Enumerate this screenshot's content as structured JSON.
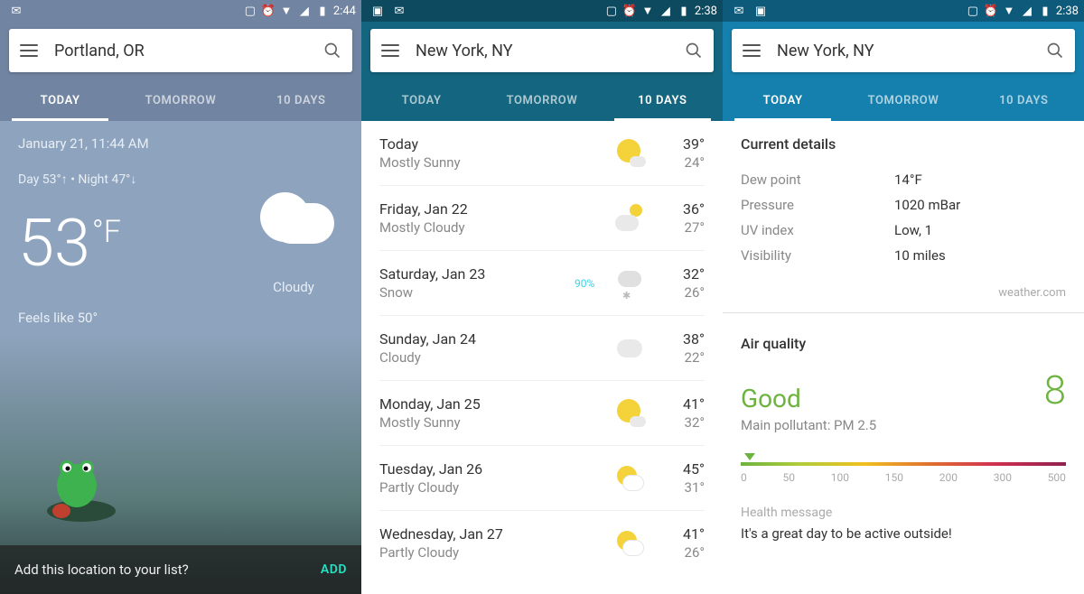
{
  "phoneA": {
    "status_time": "2:44",
    "location": "Portland, OR",
    "tabs": [
      "TODAY",
      "TOMORROW",
      "10 DAYS"
    ],
    "active_tab": 0,
    "date_time": "January 21, 11:44 AM",
    "range": "Day 53°↑ • Night 47°↓",
    "temp": "53",
    "unit": "°F",
    "feels": "Feels like 50°",
    "condition": "Cloudy",
    "prompt": "Add this location to your list?",
    "add_label": "ADD"
  },
  "phoneB": {
    "status_time": "2:38",
    "location": "New York, NY",
    "tabs": [
      "TODAY",
      "TOMORROW",
      "10 DAYS"
    ],
    "active_tab": 2,
    "forecast": [
      {
        "day": "Today",
        "cond": "Mostly Sunny",
        "hi": "39°",
        "lo": "24°",
        "icon": "sun",
        "precip": ""
      },
      {
        "day": "Friday, Jan 22",
        "cond": "Mostly Cloudy",
        "hi": "36°",
        "lo": "27°",
        "icon": "mc",
        "precip": ""
      },
      {
        "day": "Saturday, Jan 23",
        "cond": "Snow",
        "hi": "32°",
        "lo": "26°",
        "icon": "sn",
        "precip": "90%"
      },
      {
        "day": "Sunday, Jan 24",
        "cond": "Cloudy",
        "hi": "38°",
        "lo": "22°",
        "icon": "cl",
        "precip": ""
      },
      {
        "day": "Monday, Jan 25",
        "cond": "Mostly Sunny",
        "hi": "41°",
        "lo": "32°",
        "icon": "sun",
        "precip": ""
      },
      {
        "day": "Tuesday, Jan 26",
        "cond": "Partly Cloudy",
        "hi": "45°",
        "lo": "31°",
        "icon": "pc",
        "precip": ""
      },
      {
        "day": "Wednesday, Jan 27",
        "cond": "Partly Cloudy",
        "hi": "41°",
        "lo": "26°",
        "icon": "pc",
        "precip": ""
      }
    ]
  },
  "phoneC": {
    "status_time": "2:38",
    "location": "New York, NY",
    "tabs": [
      "TODAY",
      "TOMORROW",
      "10 DAYS"
    ],
    "active_tab": 0,
    "section1_title": "Current details",
    "details": [
      {
        "label": "Dew point",
        "value": "14°F"
      },
      {
        "label": "Pressure",
        "value": "1020 mBar"
      },
      {
        "label": "UV index",
        "value": "Low, 1"
      },
      {
        "label": "Visibility",
        "value": "10 miles"
      }
    ],
    "attribution": "weather.com",
    "section2_title": "Air quality",
    "aq_status": "Good",
    "aq_index": "8",
    "aq_pollutant": "Main pollutant: PM 2.5",
    "aq_ticks": [
      "0",
      "50",
      "100",
      "150",
      "200",
      "300",
      "500"
    ],
    "health_label": "Health message",
    "health_msg": "It's a great day to be active outside!"
  }
}
